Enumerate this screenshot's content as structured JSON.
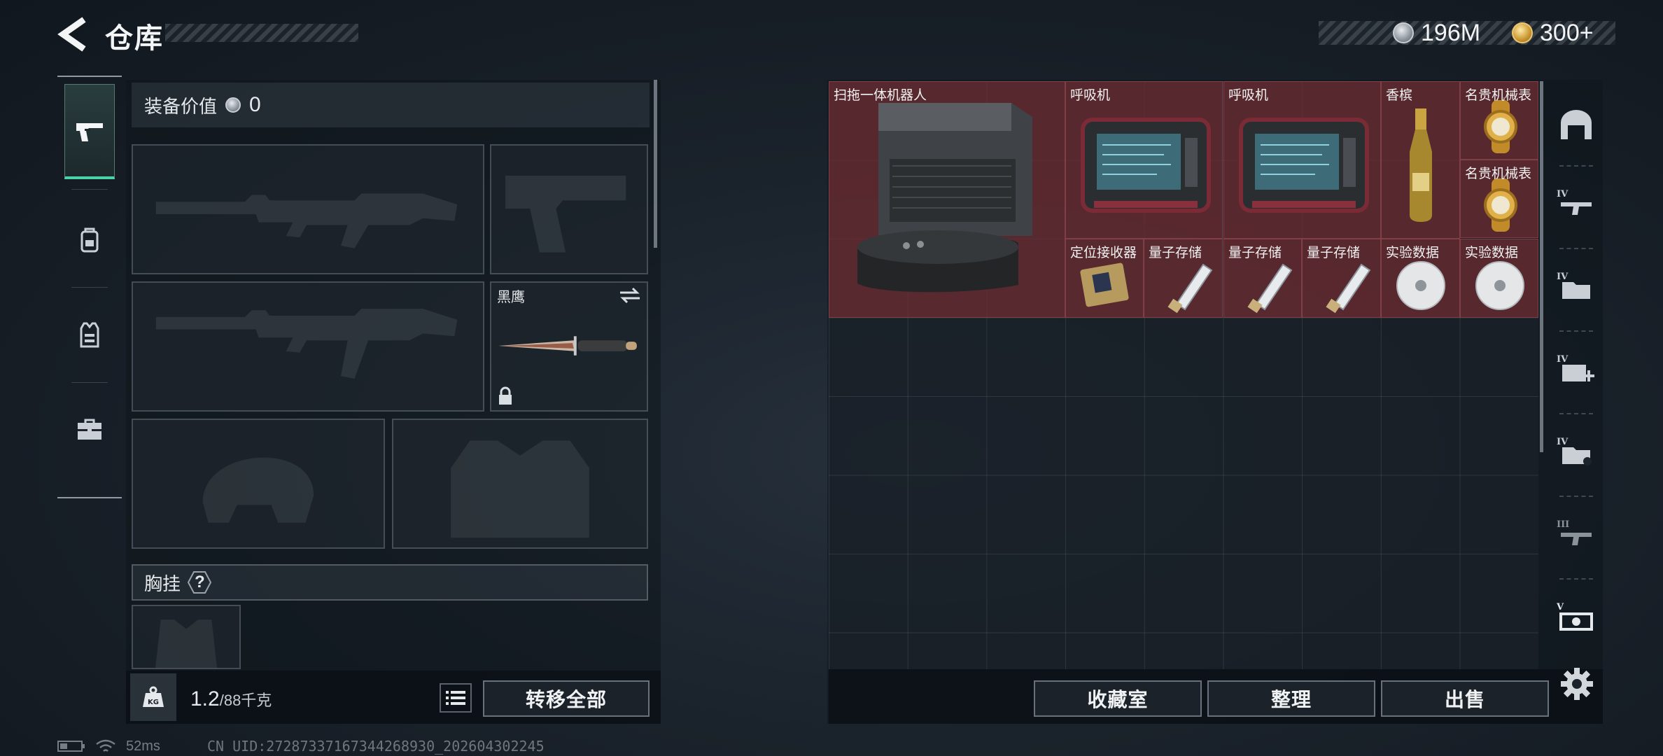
{
  "header": {
    "title": "仓库"
  },
  "currencies": [
    {
      "amount": "196M",
      "icon": "silver-coin-icon"
    },
    {
      "amount": "300+",
      "icon": "gold-coin-icon"
    }
  ],
  "equipment": {
    "value_label": "装备价值",
    "value": "0",
    "knife_name": "黑鹰",
    "chest_rig_label": "胸挂",
    "help_glyph": "?"
  },
  "capacity": {
    "current": "1.2",
    "max": "/88千克"
  },
  "buttons": {
    "transfer_all": "转移全部",
    "collection": "收藏室",
    "organize": "整理",
    "sell": "出售"
  },
  "storage_items": [
    {
      "name": "扫拖一体机器人",
      "icon": "robot-vacuum-icon"
    },
    {
      "name": "呼吸机",
      "icon": "ventilator-icon"
    },
    {
      "name": "呼吸机",
      "icon": "ventilator-icon"
    },
    {
      "name": "香槟",
      "icon": "champagne-icon"
    },
    {
      "name": "名贵机械表",
      "icon": "gold-watch-icon"
    },
    {
      "name": "名贵机械表",
      "icon": "gold-watch-icon"
    },
    {
      "name": "定位接收器",
      "icon": "gps-receiver-icon"
    },
    {
      "name": "量子存储",
      "icon": "usb-drive-icon"
    },
    {
      "name": "量子存储",
      "icon": "usb-drive-icon"
    },
    {
      "name": "量子存储",
      "icon": "usb-drive-icon"
    },
    {
      "name": "实验数据",
      "icon": "data-disc-icon"
    },
    {
      "name": "实验数据",
      "icon": "data-disc-icon"
    }
  ],
  "category_marks": [
    "IV",
    "IV",
    "IV",
    "IV",
    "III",
    "V"
  ],
  "status": {
    "ping": "52ms",
    "uid": "CN UID:272873371673442689​30_202604302245"
  }
}
